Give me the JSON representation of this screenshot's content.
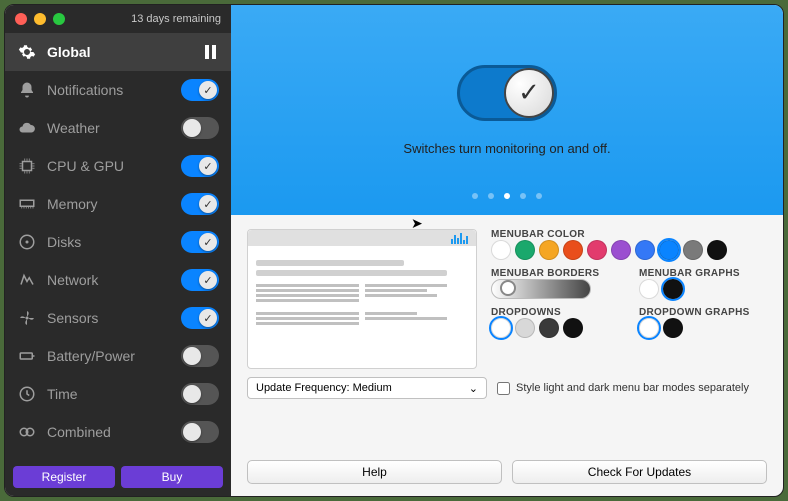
{
  "titlebar": {
    "trial": "13 days remaining"
  },
  "sidebar": {
    "items": [
      {
        "label": "Global",
        "icon": "gear-icon",
        "active": true,
        "control": "pause"
      },
      {
        "label": "Notifications",
        "icon": "bell-icon",
        "toggle": true
      },
      {
        "label": "Weather",
        "icon": "cloud-icon",
        "toggle": false
      },
      {
        "label": "CPU & GPU",
        "icon": "chip-icon",
        "toggle": true
      },
      {
        "label": "Memory",
        "icon": "memory-icon",
        "toggle": true
      },
      {
        "label": "Disks",
        "icon": "disk-icon",
        "toggle": true
      },
      {
        "label": "Network",
        "icon": "network-icon",
        "toggle": true
      },
      {
        "label": "Sensors",
        "icon": "fan-icon",
        "toggle": true
      },
      {
        "label": "Battery/Power",
        "icon": "battery-icon",
        "toggle": false
      },
      {
        "label": "Time",
        "icon": "clock-icon",
        "toggle": false
      },
      {
        "label": "Combined",
        "icon": "link-icon",
        "toggle": false
      }
    ]
  },
  "footer": {
    "register": "Register",
    "buy": "Buy"
  },
  "hero": {
    "caption": "Switches turn monitoring on and off.",
    "page_index": 2,
    "page_count": 5
  },
  "config": {
    "sections": {
      "menubar_color": "MENUBAR COLOR",
      "menubar_borders": "MENUBAR BORDERS",
      "menubar_graphs": "MENUBAR GRAPHS",
      "dropdowns": "DROPDOWNS",
      "dropdown_graphs": "DROPDOWN GRAPHS"
    },
    "colors": [
      "#ffffff",
      "#1aa86c",
      "#f5a623",
      "#e94e1b",
      "#e23b6d",
      "#9b4fd0",
      "#3478f6",
      "#0a84ff",
      "#7a7a7a",
      "#111111"
    ],
    "color_selected_index": 7,
    "menubar_graphs_colors": [
      "#ffffff",
      "#111111"
    ],
    "menubar_graphs_selected_index": 1,
    "dropdown_colors": [
      "#ffffff",
      "#d8d8d8",
      "#3a3a3a",
      "#111111"
    ],
    "dropdown_selected_index": 0,
    "dropdown_graph_colors": [
      "#ffffff",
      "#111111"
    ],
    "dropdown_graph_selected_index": 0,
    "update_select": "Update Frequency: Medium",
    "style_separately": "Style light and dark menu bar modes separately"
  },
  "bottom": {
    "help": "Help",
    "check_updates": "Check For Updates"
  }
}
